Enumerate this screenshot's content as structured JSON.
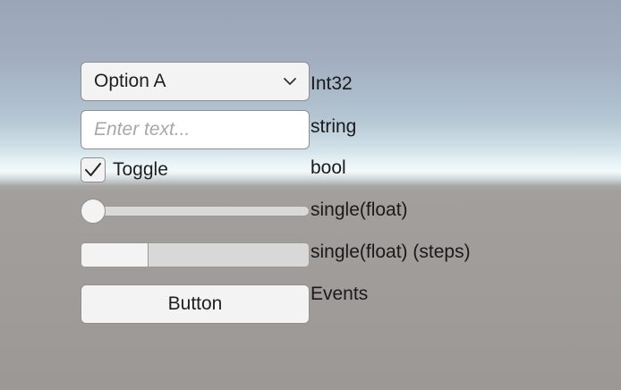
{
  "dropdown": {
    "selected": "Option A",
    "type_label": "Int32",
    "icon": "chevron-down-icon"
  },
  "textfield": {
    "value": "",
    "placeholder": "Enter text...",
    "type_label": "string"
  },
  "toggle": {
    "label": "Toggle",
    "checked": true,
    "type_label": "bool",
    "icon": "checkmark-icon"
  },
  "slider": {
    "value_fraction": 0,
    "type_label": "single(float)"
  },
  "stepped_slider": {
    "value_fraction": 0.29,
    "type_label": "single(float) (steps)"
  },
  "button": {
    "label": "Button",
    "type_label": "Events"
  },
  "colors": {
    "control_bg": "#f3f3f3",
    "control_border": "#8f8f8f",
    "track_bg": "#d9d9d9",
    "text": "#1f1f1f",
    "placeholder": "#a8a8a8"
  }
}
